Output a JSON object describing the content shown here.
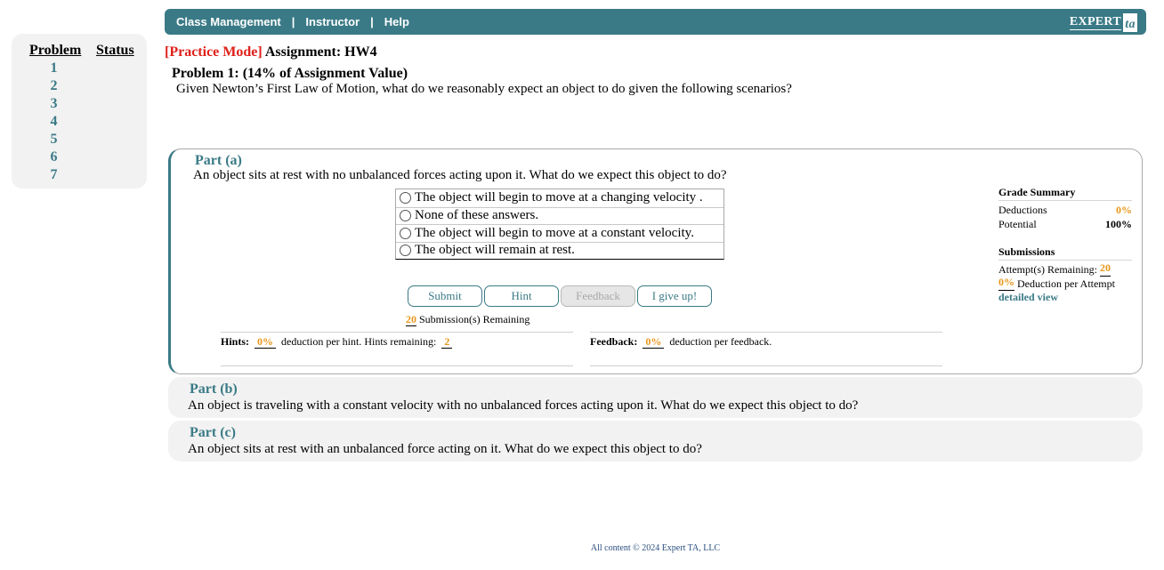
{
  "nav": {
    "links": [
      "Class Management",
      "Instructor",
      "Help"
    ],
    "separator": "|",
    "brand": "EXPERT",
    "brand_mark": "ta"
  },
  "sidebar": {
    "col_problem": "Problem",
    "col_status": "Status",
    "problems": [
      "1",
      "2",
      "3",
      "4",
      "5",
      "6",
      "7"
    ]
  },
  "header": {
    "mode": "[Practice Mode]",
    "assignment": "Assignment: HW4",
    "problem_title": "Problem 1: (14% of Assignment Value)",
    "prompt": "Given Newton’s First Law of Motion, what do we reasonably expect an object to do given the following scenarios?"
  },
  "part_a": {
    "label": "Part (a)",
    "question": "An object sits at rest with no unbalanced forces acting upon it. What do we expect this object to do?",
    "choices": [
      "The object will begin to move at a changing velocity .",
      "None of these answers.",
      "The object will begin to move at a constant velocity.",
      "The object will remain at rest."
    ],
    "buttons": {
      "submit": "Submit",
      "hint": "Hint",
      "feedback": "Feedback",
      "giveup": "I give up!"
    },
    "submissions_remaining_count": "20",
    "submissions_remaining_text": "Submission(s) Remaining",
    "hints": {
      "label": "Hints:",
      "deduction": "0%",
      "text": "deduction per hint. Hints remaining:",
      "remaining": "2"
    },
    "feedback": {
      "label": "Feedback:",
      "deduction": "0%",
      "text": "deduction per feedback."
    }
  },
  "grade_summary": {
    "heading": "Grade Summary",
    "deductions_label": "Deductions",
    "deductions_value": "0%",
    "potential_label": "Potential",
    "potential_value": "100%",
    "submissions_heading": "Submissions",
    "attempts_label": "Attempt(s) Remaining:",
    "attempts_value": "20",
    "deduction_per_attempt_value": "0%",
    "deduction_per_attempt_text": "Deduction per Attempt",
    "detailed_view": "detailed view"
  },
  "part_b": {
    "label": "Part (b)",
    "question": "An object is traveling with a constant velocity with no unbalanced forces acting upon it. What do we expect this object to do?"
  },
  "part_c": {
    "label": "Part (c)",
    "question": "An object sits at rest with an unbalanced force acting on it. What do we expect this object to do?"
  },
  "footer": "All content © 2024 Expert TA, LLC",
  "colors": {
    "accent": "#3a7a86",
    "highlight": "#e8961a",
    "mode": "#e0201a"
  }
}
